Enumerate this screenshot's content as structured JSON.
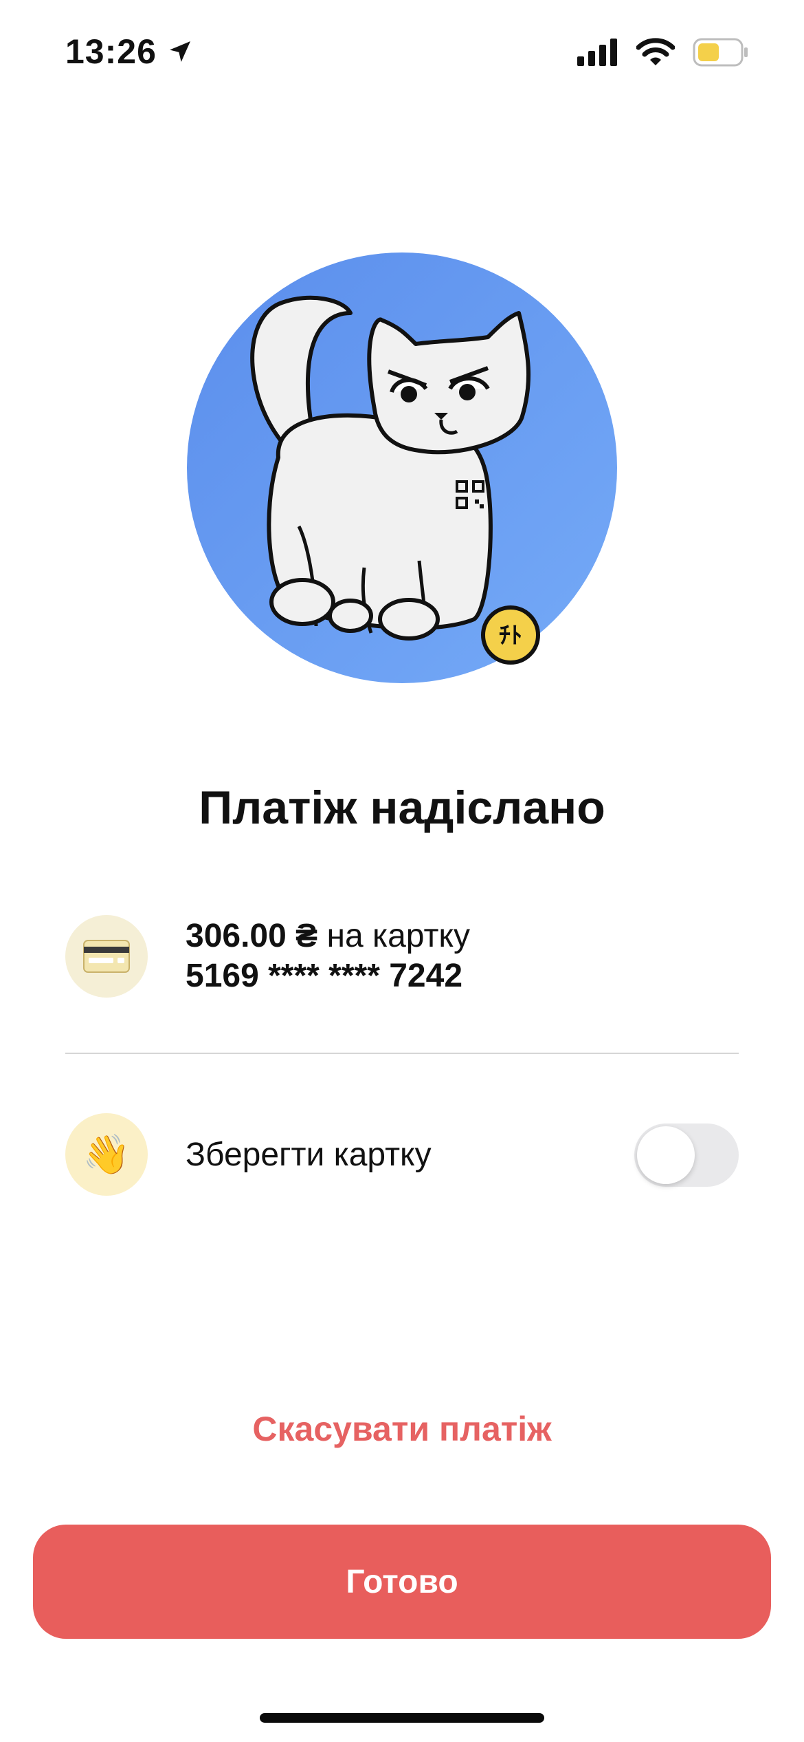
{
  "status_bar": {
    "time": "13:26",
    "icons": [
      "location-arrow-icon",
      "cellular-signal-icon",
      "wifi-icon",
      "battery-icon"
    ],
    "battery_color": "#f4d04a"
  },
  "hero": {
    "circle_color": "#5e96ee",
    "coin_label": "ﾁﾄ",
    "icon": "cat-illustration"
  },
  "title": "Платіж надіслано",
  "card": {
    "amount": "306.00 ₴",
    "suffix": " на картку",
    "number": "5169 **** **** 7242",
    "icon": "credit-card-icon"
  },
  "save_card": {
    "label": "Зберегти картку",
    "icon": "waving-hand-icon",
    "toggle_on": false
  },
  "cancel_label": "Скасувати платіж",
  "done_label": "Готово",
  "colors": {
    "accent": "#e85e5c",
    "cancel": "#e66262"
  }
}
